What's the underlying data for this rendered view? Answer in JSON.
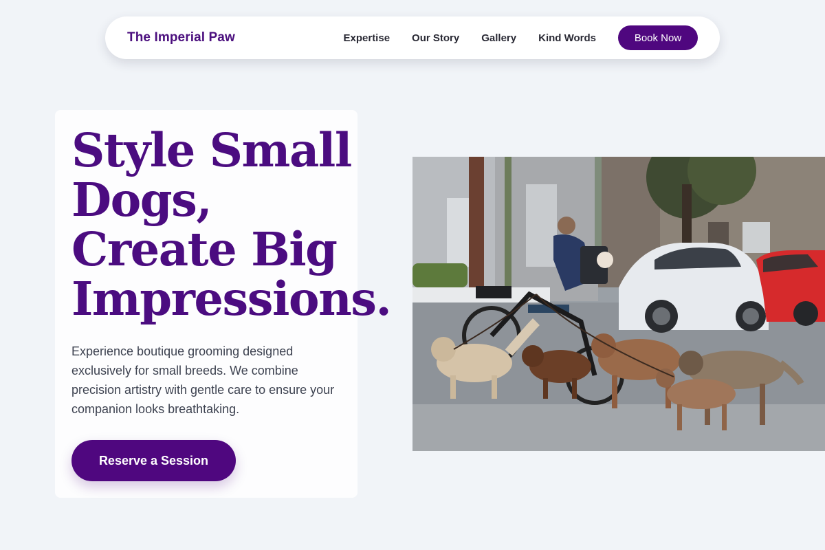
{
  "nav": {
    "brand": "The Imperial Paw",
    "links": [
      "Expertise",
      "Our Story",
      "Gallery",
      "Kind Words"
    ],
    "cta_label": "Book Now"
  },
  "hero": {
    "title_lines": [
      "Style Small",
      "Dogs,",
      "Create Big",
      "Impressions."
    ],
    "subtitle": "Experience boutique grooming designed exclusively for small breeds. We combine precision artistry with gentle care to ensure your companion looks breathtaking.",
    "cta_label": "Reserve a Session"
  },
  "image": {
    "alt": "Person on a bicycle walking a pack of dogs on a city street"
  },
  "colors": {
    "accent": "#4f077f",
    "brand_text": "#4b0f7e",
    "page_bg": "#f1f4f8"
  }
}
